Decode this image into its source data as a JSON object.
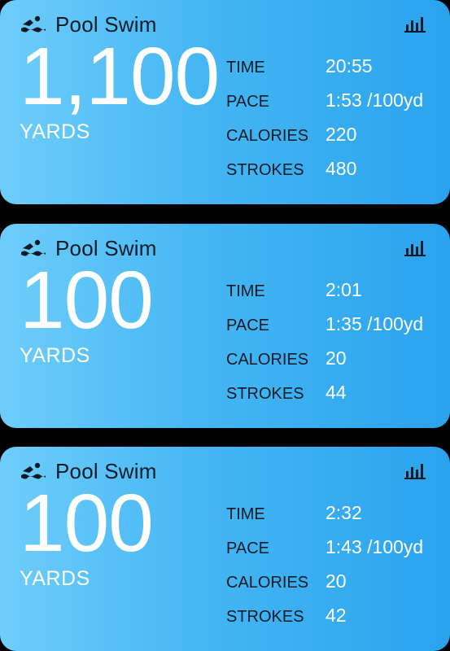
{
  "icons": {
    "activity": "swimmer-icon",
    "details": "bar-chart-icon"
  },
  "colors": {
    "card_gradient_start": "#6fcdfb",
    "card_gradient_end": "#2aa3ee",
    "label_text": "#0d1b26",
    "value_text": "#ffffff"
  },
  "cards": [
    {
      "title": "Pool Swim",
      "distance": "1,100",
      "unit": "YARDS",
      "metrics": [
        {
          "label": "TIME",
          "value": "20:55"
        },
        {
          "label": "PACE",
          "value": "1:53 /100yd"
        },
        {
          "label": "CALORIES",
          "value": "220"
        },
        {
          "label": "STROKES",
          "value": "480"
        }
      ]
    },
    {
      "title": "Pool Swim",
      "distance": "100",
      "unit": "YARDS",
      "metrics": [
        {
          "label": "TIME",
          "value": "2:01"
        },
        {
          "label": "PACE",
          "value": "1:35 /100yd"
        },
        {
          "label": "CALORIES",
          "value": "20"
        },
        {
          "label": "STROKES",
          "value": "44"
        }
      ]
    },
    {
      "title": "Pool Swim",
      "distance": "100",
      "unit": "YARDS",
      "metrics": [
        {
          "label": "TIME",
          "value": "2:32"
        },
        {
          "label": "PACE",
          "value": "1:43 /100yd"
        },
        {
          "label": "CALORIES",
          "value": "20"
        },
        {
          "label": "STROKES",
          "value": "42"
        }
      ]
    }
  ]
}
